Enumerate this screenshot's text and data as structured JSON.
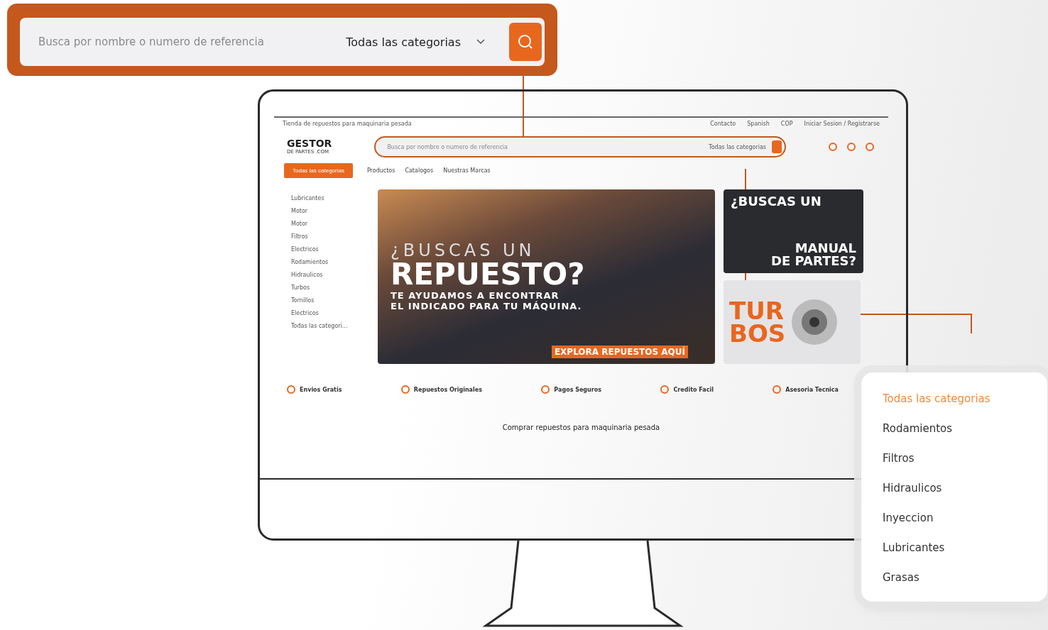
{
  "callout_search": {
    "placeholder": "Busca por nombre o numero de referencia",
    "category": "Todas las categorias"
  },
  "site": {
    "topbar": {
      "tagline": "Tienda de repuestos para maquinaria pesada",
      "links": [
        "Contacto",
        "Spanish",
        "COP",
        "Iniciar Sesion / Registrarse"
      ]
    },
    "logo": {
      "name": "GESTOR",
      "sub": "DE PARTES .COM"
    },
    "search": {
      "placeholder": "Busca por nombre o numero de referencia",
      "category": "Todas las categorias"
    },
    "all_categories_button": "Todas las categorias",
    "nav": [
      "Productos",
      "Catalogos",
      "Nuestras Marcas"
    ],
    "sidebar": [
      {
        "label": "Lubricantes"
      },
      {
        "label": "Motor"
      },
      {
        "label": "Motor"
      },
      {
        "label": "Filtros"
      },
      {
        "label": "Electricos"
      },
      {
        "label": "Rodamientos"
      },
      {
        "label": "Hidraulicos"
      },
      {
        "label": "Turbos"
      },
      {
        "label": "Tornillos"
      },
      {
        "label": "Electricos"
      }
    ],
    "sidebar_all": "Todas las categori...",
    "hero": {
      "line1": "¿BUSCAS UN",
      "line2": "REPUESTO?",
      "line3": "TE AYUDAMOS A ENCONTRAR",
      "line4": "EL INDICADO PARA TU MÁQUINA.",
      "cta": "EXPLORA REPUESTOS AQUÍ"
    },
    "promo_manual": {
      "line1": "¿BUSCAS UN",
      "line2": "MANUAL",
      "line3": "DE PARTES?"
    },
    "promo_turbos": {
      "line1": "TUR",
      "line2": "BOS"
    },
    "features": [
      "Envios Gratis",
      "Repuestos Originales",
      "Pagos Seguros",
      "Credito Facil",
      "Asesoria Tecnica"
    ],
    "footer_title": "Comprar repuestos para maquinaria pesada"
  },
  "dropdown": {
    "items": [
      {
        "label": "Todas las categorias",
        "selected": true
      },
      {
        "label": "Rodamientos",
        "selected": false
      },
      {
        "label": "Filtros",
        "selected": false
      },
      {
        "label": "Hidraulicos",
        "selected": false
      },
      {
        "label": "Inyeccion",
        "selected": false
      },
      {
        "label": "Lubricantes",
        "selected": false
      },
      {
        "label": "Grasas",
        "selected": false
      }
    ]
  }
}
